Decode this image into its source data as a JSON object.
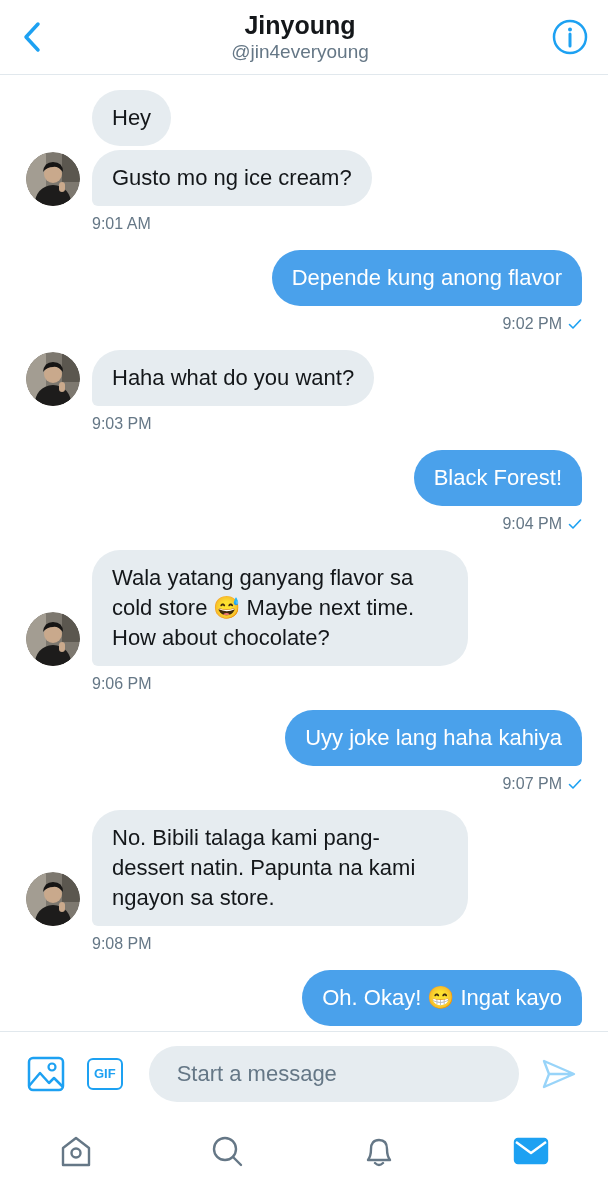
{
  "header": {
    "title": "Jinyoung",
    "handle": "@jin4everyoung"
  },
  "messages": [
    {
      "kind": "received",
      "bubbles": [
        "Hey",
        "Gusto mo ng ice cream?"
      ],
      "time": "9:01 AM"
    },
    {
      "kind": "sent",
      "bubbles": [
        "Depende kung anong flavor"
      ],
      "time": "9:02 PM",
      "read": true
    },
    {
      "kind": "received",
      "bubbles": [
        "Haha what do you want?"
      ],
      "time": "9:03 PM"
    },
    {
      "kind": "sent",
      "bubbles": [
        "Black Forest!"
      ],
      "time": "9:04 PM",
      "read": true
    },
    {
      "kind": "received",
      "bubbles": [
        "Wala yatang ganyang flavor sa cold store 😅 Maybe next time. How about chocolate?"
      ],
      "time": "9:06 PM"
    },
    {
      "kind": "sent",
      "bubbles": [
        "Uyy joke lang haha kahiya"
      ],
      "time": "9:07 PM",
      "read": true
    },
    {
      "kind": "received",
      "bubbles": [
        "No. Bibili talaga kami pang-dessert natin. Papunta na kami ngayon sa store."
      ],
      "time": "9:08 PM"
    },
    {
      "kind": "sent",
      "bubbles": [
        "Oh. Okay! 😁 Ingat kayo"
      ]
    }
  ],
  "composer": {
    "gif_label": "GIF",
    "placeholder": "Start a message",
    "send_disabled": true
  },
  "tabs": [
    {
      "kind": "home",
      "selected": false
    },
    {
      "kind": "search",
      "selected": false
    },
    {
      "kind": "notifications",
      "selected": false
    },
    {
      "kind": "messages",
      "selected": true
    }
  ]
}
